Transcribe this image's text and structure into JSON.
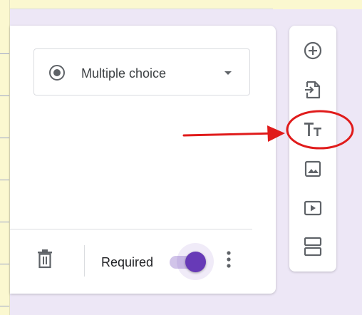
{
  "question": {
    "type_select": {
      "selected": "Multiple choice",
      "icon": "radio-button-checked-icon",
      "caret_icon": "arrow-drop-down-icon"
    },
    "footer": {
      "delete_icon": "trash-icon",
      "required_label": "Required",
      "required_on": true,
      "more_icon": "more-vert-icon"
    }
  },
  "toolbar": {
    "tools": [
      {
        "id": "add-question",
        "icon": "add-circle-icon"
      },
      {
        "id": "import-questions",
        "icon": "import-icon"
      },
      {
        "id": "add-title-description",
        "icon": "title-text-icon"
      },
      {
        "id": "add-image",
        "icon": "image-icon"
      },
      {
        "id": "add-video",
        "icon": "video-icon"
      },
      {
        "id": "add-section",
        "icon": "section-icon"
      }
    ]
  },
  "annotation": {
    "color": "#e01b1b",
    "target": "add-title-description"
  },
  "colors": {
    "accent": "#673ab7",
    "page_background": "#ede7f6",
    "icon": "#5f6368"
  }
}
